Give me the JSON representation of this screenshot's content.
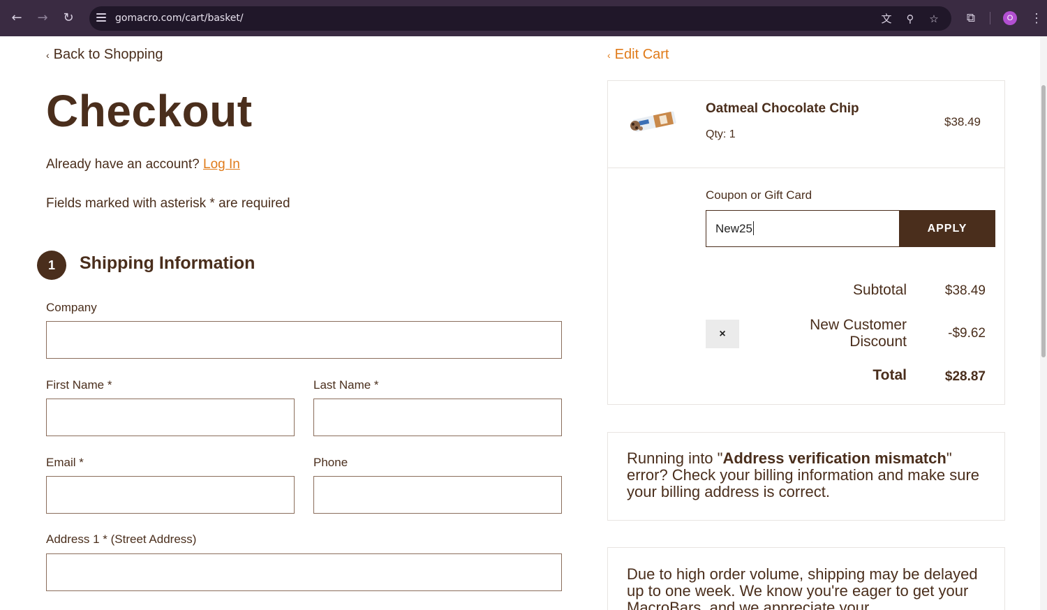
{
  "browser": {
    "url": "gomacro.com/cart/basket/",
    "profile_initial": "O",
    "icons": [
      "back-icon",
      "forward-icon",
      "reload-icon",
      "site-settings-icon",
      "translate-icon",
      "zoom-icon",
      "bookmark-star-icon",
      "extensions-icon",
      "profile-avatar",
      "menu-kebab-icon"
    ]
  },
  "left": {
    "back_link": "Back to Shopping",
    "title": "Checkout",
    "account_prompt": "Already have an account?",
    "login_link": "Log In",
    "required_note": "Fields marked with asterisk * are required",
    "step_number": "1",
    "section_title": "Shipping Information",
    "fields": {
      "company": "Company",
      "first_name": "First Name *",
      "last_name": "Last Name *",
      "email": "Email *",
      "phone": "Phone",
      "address1": "Address 1 * (Street Address)"
    }
  },
  "cart": {
    "edit_link": "Edit Cart",
    "product": {
      "name": "Oatmeal Chocolate Chip",
      "qty": "Qty: 1",
      "price": "$38.49"
    },
    "coupon": {
      "label": "Coupon or Gift Card",
      "value": "New25",
      "apply_label": "APPLY"
    },
    "summary": {
      "subtotal_label": "Subtotal",
      "subtotal_value": "$38.49",
      "discount_label_1": "New Customer",
      "discount_label_2": "Discount",
      "discount_value": "-$9.62",
      "remove_symbol": "×",
      "total_label": "Total",
      "total_value": "$28.87"
    }
  },
  "notices": {
    "address_pre": "Running into \"",
    "address_bold": "Address verification mismatch",
    "address_post": "\" error? Check your billing information and make sure your billing address is correct.",
    "shipping": "Due to high order volume, shipping may be delayed up to one week. We know you're eager to get your MacroBars, and we appreciate your"
  },
  "colors": {
    "brand_brown": "#4a2e1c",
    "accent_orange": "#e07b1a",
    "chrome_bg": "#3a2b42"
  }
}
